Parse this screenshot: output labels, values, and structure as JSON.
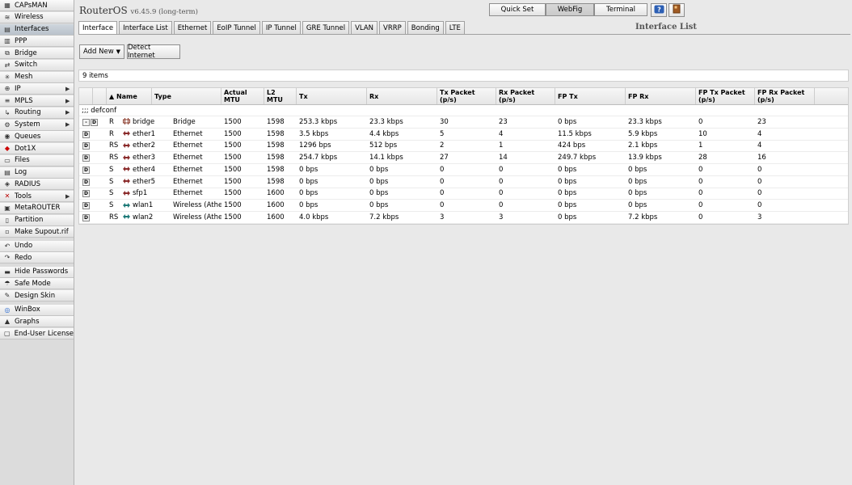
{
  "app": {
    "brand": "RouterOS",
    "version": "v6.45.9 (long-term)"
  },
  "header_buttons": [
    "Quick Set",
    "WebFig",
    "Terminal"
  ],
  "sidebar": {
    "items": [
      {
        "label": "CAPsMAN",
        "icon": "capsman-icon",
        "arrow": false
      },
      {
        "label": "Wireless",
        "icon": "wireless-icon",
        "arrow": false
      },
      {
        "label": "Interfaces",
        "icon": "interfaces-icon",
        "arrow": false,
        "active": true
      },
      {
        "label": "PPP",
        "icon": "ppp-icon",
        "arrow": false
      },
      {
        "label": "Bridge",
        "icon": "bridge-icon",
        "arrow": false
      },
      {
        "label": "Switch",
        "icon": "switch-icon",
        "arrow": false
      },
      {
        "label": "Mesh",
        "icon": "mesh-icon",
        "arrow": false
      },
      {
        "label": "IP",
        "icon": "ip-icon",
        "arrow": true
      },
      {
        "label": "MPLS",
        "icon": "mpls-icon",
        "arrow": true
      },
      {
        "label": "Routing",
        "icon": "routing-icon",
        "arrow": true
      },
      {
        "label": "System",
        "icon": "system-icon",
        "arrow": true
      },
      {
        "label": "Queues",
        "icon": "queues-icon",
        "arrow": false
      },
      {
        "label": "Dot1X",
        "icon": "dot1x-icon",
        "arrow": false
      },
      {
        "label": "Files",
        "icon": "files-icon",
        "arrow": false
      },
      {
        "label": "Log",
        "icon": "log-icon",
        "arrow": false
      },
      {
        "label": "RADIUS",
        "icon": "radius-icon",
        "arrow": false
      },
      {
        "label": "Tools",
        "icon": "tools-icon",
        "arrow": true
      },
      {
        "label": "MetaROUTER",
        "icon": "metarouter-icon",
        "arrow": false
      },
      {
        "label": "Partition",
        "icon": "partition-icon",
        "arrow": false
      },
      {
        "label": "Make Supout.rif",
        "icon": "supout-icon",
        "arrow": false
      },
      {
        "label": "Undo",
        "icon": "undo-icon",
        "arrow": false
      },
      {
        "label": "Redo",
        "icon": "redo-icon",
        "arrow": false
      },
      {
        "label": "Hide Passwords",
        "icon": "hide-passwords-icon",
        "arrow": false
      },
      {
        "label": "Safe Mode",
        "icon": "safe-mode-icon",
        "arrow": false
      },
      {
        "label": "Design Skin",
        "icon": "design-skin-icon",
        "arrow": false
      },
      {
        "label": "WinBox",
        "icon": "winbox-icon",
        "arrow": false
      },
      {
        "label": "Graphs",
        "icon": "graphs-icon",
        "arrow": false
      },
      {
        "label": "End-User License",
        "icon": "license-icon",
        "arrow": false
      }
    ]
  },
  "tabs": [
    "Interface",
    "Interface List",
    "Ethernet",
    "EoIP Tunnel",
    "IP Tunnel",
    "GRE Tunnel",
    "VLAN",
    "VRRP",
    "Bonding",
    "LTE"
  ],
  "page_title": "Interface List",
  "actions": {
    "add_new": "Add New",
    "detect_internet": "Detect Internet"
  },
  "item_count": "9 items",
  "table": {
    "columns": [
      "",
      "",
      "▲ Name",
      "Type",
      "Actual MTU",
      "L2 MTU",
      "Tx",
      "Rx",
      "Tx Packet (p/s)",
      "Rx Packet (p/s)",
      "FP Tx",
      "FP Rx",
      "FP Tx Packet (p/s)",
      "FP Rx Packet (p/s)"
    ],
    "comment": ";;; defconf",
    "rows": [
      {
        "ctrl": "-D",
        "flags": "R",
        "name": "bridge",
        "icon": "bridge",
        "type": "Bridge",
        "mtu": "1500",
        "l2mtu": "1598",
        "tx": "253.3 kbps",
        "rx": "23.3 kbps",
        "txp": "30",
        "rxp": "23",
        "fptx": "0 bps",
        "fprx": "23.3 kbps",
        "fptxp": "0",
        "fprxp": "23"
      },
      {
        "ctrl": "D",
        "flags": "R",
        "name": "ether1",
        "icon": "ether",
        "type": "Ethernet",
        "mtu": "1500",
        "l2mtu": "1598",
        "tx": "3.5 kbps",
        "rx": "4.4 kbps",
        "txp": "5",
        "rxp": "4",
        "fptx": "11.5 kbps",
        "fprx": "5.9 kbps",
        "fptxp": "10",
        "fprxp": "4"
      },
      {
        "ctrl": "D",
        "flags": "RS",
        "name": "ether2",
        "icon": "ether",
        "type": "Ethernet",
        "mtu": "1500",
        "l2mtu": "1598",
        "tx": "1296 bps",
        "rx": "512 bps",
        "txp": "2",
        "rxp": "1",
        "fptx": "424 bps",
        "fprx": "2.1 kbps",
        "fptxp": "1",
        "fprxp": "4"
      },
      {
        "ctrl": "D",
        "flags": "RS",
        "name": "ether3",
        "icon": "ether",
        "type": "Ethernet",
        "mtu": "1500",
        "l2mtu": "1598",
        "tx": "254.7 kbps",
        "rx": "14.1 kbps",
        "txp": "27",
        "rxp": "14",
        "fptx": "249.7 kbps",
        "fprx": "13.9 kbps",
        "fptxp": "28",
        "fprxp": "16"
      },
      {
        "ctrl": "D",
        "flags": "S",
        "name": "ether4",
        "icon": "ether",
        "type": "Ethernet",
        "mtu": "1500",
        "l2mtu": "1598",
        "tx": "0 bps",
        "rx": "0 bps",
        "txp": "0",
        "rxp": "0",
        "fptx": "0 bps",
        "fprx": "0 bps",
        "fptxp": "0",
        "fprxp": "0"
      },
      {
        "ctrl": "D",
        "flags": "S",
        "name": "ether5",
        "icon": "ether",
        "type": "Ethernet",
        "mtu": "1500",
        "l2mtu": "1598",
        "tx": "0 bps",
        "rx": "0 bps",
        "txp": "0",
        "rxp": "0",
        "fptx": "0 bps",
        "fprx": "0 bps",
        "fptxp": "0",
        "fprxp": "0"
      },
      {
        "ctrl": "D",
        "flags": "S",
        "name": "sfp1",
        "icon": "ether",
        "type": "Ethernet",
        "mtu": "1500",
        "l2mtu": "1600",
        "tx": "0 bps",
        "rx": "0 bps",
        "txp": "0",
        "rxp": "0",
        "fptx": "0 bps",
        "fprx": "0 bps",
        "fptxp": "0",
        "fprxp": "0"
      },
      {
        "ctrl": "D",
        "flags": "S",
        "name": "wlan1",
        "icon": "wlan",
        "type": "Wireless (Atheros AR9",
        "mtu": "1500",
        "l2mtu": "1600",
        "tx": "0 bps",
        "rx": "0 bps",
        "txp": "0",
        "rxp": "0",
        "fptx": "0 bps",
        "fprx": "0 bps",
        "fptxp": "0",
        "fprxp": "0"
      },
      {
        "ctrl": "D",
        "flags": "RS",
        "name": "wlan2",
        "icon": "wlan",
        "type": "Wireless (Atheros AR9",
        "mtu": "1500",
        "l2mtu": "1600",
        "tx": "4.0 kbps",
        "rx": "7.2 kbps",
        "txp": "3",
        "rxp": "3",
        "fptx": "0 bps",
        "fprx": "7.2 kbps",
        "fptxp": "0",
        "fprxp": "3"
      }
    ]
  }
}
